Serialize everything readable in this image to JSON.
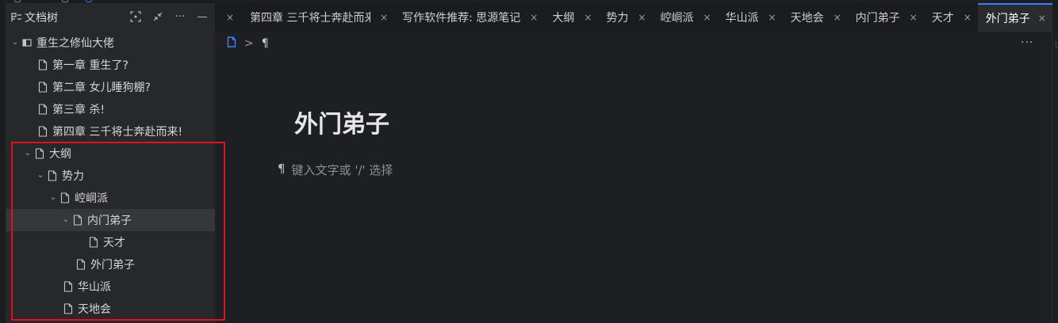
{
  "sidebar": {
    "title": "文档树",
    "actions": [
      "focus",
      "collapse",
      "more",
      "minimize"
    ],
    "tree": [
      {
        "label": "重生之修仙大佬",
        "level": 0,
        "expanded": true,
        "kind": "notebook"
      },
      {
        "label": "第一章 重生了?",
        "level": 1,
        "kind": "doc"
      },
      {
        "label": "第二章 女儿睡狗棚?",
        "level": 1,
        "kind": "doc"
      },
      {
        "label": "第三章 杀!",
        "level": 1,
        "kind": "doc"
      },
      {
        "label": "第四章 三千将士奔赴而来!",
        "level": 1,
        "kind": "doc"
      },
      {
        "label": "大纲",
        "level": 1,
        "expanded": true,
        "kind": "doc"
      },
      {
        "label": "势力",
        "level": 2,
        "expanded": true,
        "kind": "doc"
      },
      {
        "label": "崆峒派",
        "level": 3,
        "expanded": true,
        "kind": "doc"
      },
      {
        "label": "内门弟子",
        "level": 4,
        "expanded": true,
        "kind": "doc",
        "highlighted": true
      },
      {
        "label": "天才",
        "level": 5,
        "kind": "doc"
      },
      {
        "label": "外门弟子",
        "level": 4,
        "kind": "doc"
      },
      {
        "label": "华山派",
        "level": 3,
        "kind": "doc"
      },
      {
        "label": "天地会",
        "level": 3,
        "kind": "doc"
      }
    ]
  },
  "tabs": [
    {
      "label": "",
      "close": "×",
      "lead": true
    },
    {
      "label": "第四章 三千将士奔赴而来",
      "close": "×"
    },
    {
      "label": "写作软件推荐: 思源笔记",
      "close": "×"
    },
    {
      "label": "大纲",
      "close": "×"
    },
    {
      "label": "势力",
      "close": "×"
    },
    {
      "label": "崆峒派",
      "close": "×"
    },
    {
      "label": "华山派",
      "close": "×"
    },
    {
      "label": "天地会",
      "close": "×"
    },
    {
      "label": "内门弟子",
      "close": "×"
    },
    {
      "label": "天才",
      "close": "×"
    },
    {
      "label": "外门弟子",
      "close": "×",
      "active": true
    }
  ],
  "breadcrumb": {
    "separator": ">",
    "block_icon": "¶"
  },
  "editor": {
    "title": "外门弟子",
    "placeholder_icon": "¶",
    "placeholder": "键入文字或 '/' 选择",
    "more": "···"
  },
  "colors": {
    "accent": "#3d7cff",
    "highlight_box": "#e0121b"
  }
}
